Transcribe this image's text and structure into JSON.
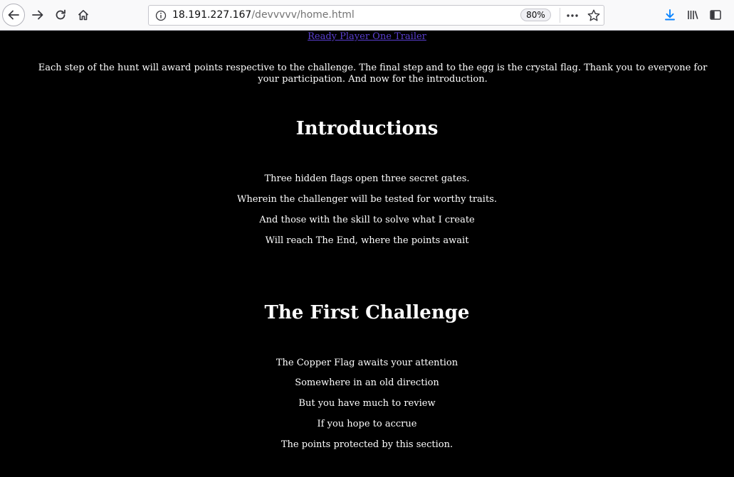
{
  "browser": {
    "url_host": "18.191.227.167",
    "url_path": "/devvvvv/home.html",
    "zoom": "80%"
  },
  "page": {
    "trailer_link": "Ready Player One Trailer",
    "intro_paragraph": "Each step of the hunt will award points respective to the challenge. The final step and to the egg is the crystal flag. Thank you to everyone for your participation. And now for the introduction.",
    "introductions": {
      "heading": "Introductions",
      "lines": [
        "Three hidden flags open three secret gates.",
        "Wherein the challenger will be tested for worthy traits.",
        "And those with the skill to solve what I create",
        "Will reach The End, where the points await"
      ]
    },
    "first_challenge": {
      "heading": "The First Challenge",
      "lines": [
        "The Copper Flag awaits your attention",
        "Somewhere in an old direction",
        "But you have much to review",
        "If you hope to accrue",
        "The points protected by this section."
      ]
    }
  }
}
